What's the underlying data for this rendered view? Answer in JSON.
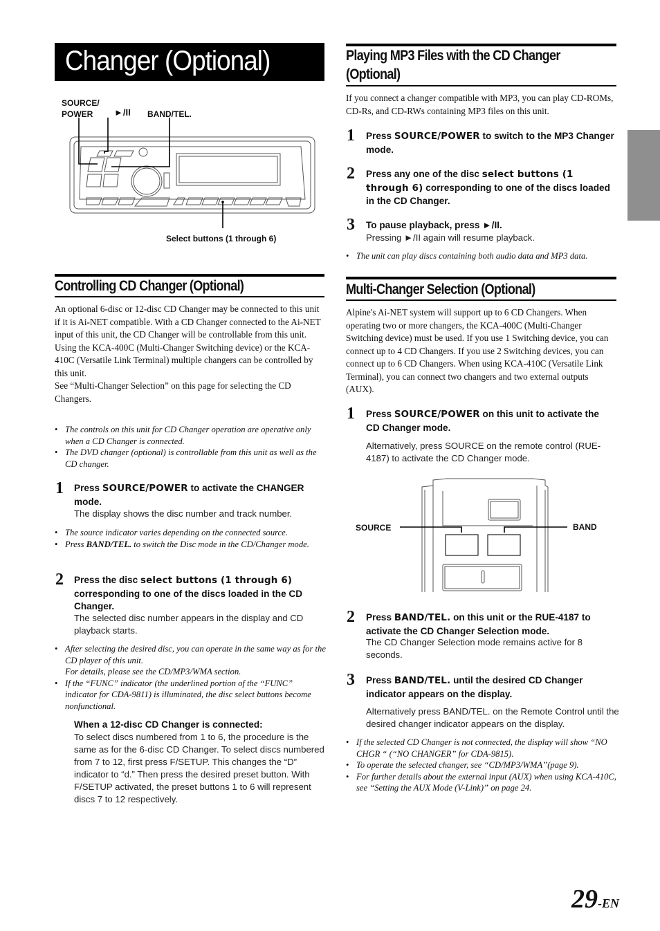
{
  "page": {
    "title": "Changer (Optional)",
    "page_number": "29",
    "page_suffix": "-EN"
  },
  "diagram_unit": {
    "label_source_power_1": "SOURCE/",
    "label_source_power_2": "POWER",
    "label_play_pause": "►/II",
    "label_band_tel": "BAND/TEL.",
    "label_select_buttons": "Select buttons (1 through 6)"
  },
  "controlling": {
    "heading": "Controlling CD Changer (Optional)",
    "paragraphs": [
      "An optional 6-disc or 12-disc CD Changer may be connected to this unit if it is Ai-NET compatible. With a CD Changer connected to the Ai-NET input of this unit, the CD Changer will be controllable from this unit.",
      "Using the KCA-400C (Multi-Changer Switching device) or the KCA-410C (Versatile Link Terminal) multiple changers can be controlled by this unit.",
      "See “Multi-Changer Selection” on this page for selecting the CD Changers."
    ],
    "notes_1": [
      "The controls on this unit for CD Changer operation are operative only when a CD Changer is connected.",
      "The DVD changer (optional) is controllable from this unit as well as the CD changer."
    ],
    "step1": {
      "num": "1",
      "pre": "Press ",
      "kw": "SOURCE/POWER",
      "post": " to activate the CHANGER mode.",
      "body": "The display shows the disc number and track number."
    },
    "notes_2": [
      "The source indicator varies depending on the connected source."
    ],
    "note_2b_pre": "Press ",
    "note_2b_kw": "BAND/TEL.",
    "note_2b_post": " to switch the Disc mode in the CD/Changer mode.",
    "step2": {
      "num": "2",
      "pre": "Press the disc ",
      "kw": "select buttons (1 through 6)",
      "post": " corresponding to one of the discs loaded in the CD Changer.",
      "body": "The selected disc number appears in the display and CD playback starts."
    },
    "notes_3a": "After selecting the desired disc, you can operate in the same way as for the CD player of this unit.",
    "notes_3a2": "For details, please see the CD/MP3/WMA section.",
    "notes_3b": "If the “FUNC” indicator (the underlined portion of the “FUNC” indicator for CDA-9811) is illuminated, the disc select buttons become nonfunctional.",
    "twelve_disc": {
      "heading": "When a 12-disc CD Changer is connected:",
      "t1": "To select discs numbered from 1 to 6, the procedure is the same as for the 6-disc CD Changer. To select discs numbered from 7 to 12, first press ",
      "k1": "F/SETUP",
      "t2": ". This changes the “D” indicator to “d.” Then press the desired ",
      "k2": "preset button",
      "t3": ". With ",
      "k3": "F/SETUP",
      "t4": " activated, the preset buttons 1 to 6 will represent discs 7 to 12 respectively."
    }
  },
  "mp3": {
    "heading_1": "Playing MP3 Files with the CD Changer",
    "heading_2": "(Optional)",
    "intro": "If you connect a changer compatible with MP3, you can play CD-ROMs, CD-Rs, and CD-RWs containing MP3 files on this unit.",
    "step1": {
      "num": "1",
      "pre": "Press ",
      "kw": "SOURCE/POWER",
      "post": " to switch to the MP3 Changer mode."
    },
    "step2": {
      "num": "2",
      "pre": "Press any one of the disc ",
      "kw": "select buttons (1 through 6)",
      "post": " corresponding to one of the discs loaded in the CD Changer."
    },
    "step3": {
      "num": "3",
      "head": "To pause playback, press ►/II.",
      "body": "Pressing ►/II again will resume playback."
    },
    "note": "The unit can play discs containing both audio data and MP3 data."
  },
  "multi": {
    "heading": "Multi-Changer Selection (Optional)",
    "intro": "Alpine's Ai-NET system will support up to 6 CD Changers. When operating two or more changers, the KCA-400C (Multi-Changer Switching device) must be used. If you use 1 Switching device, you can connect up to 4 CD Changers. If you use 2 Switching devices, you can connect up to 6 CD Changers. When using KCA-410C (Versatile Link Terminal), you can connect two changers and two external outputs (AUX).",
    "step1": {
      "num": "1",
      "pre": "Press ",
      "kw": "SOURCE/POWER",
      "post": " on this unit to activate the CD Changer mode.",
      "body_pre": "Alternatively, press ",
      "body_kw": "SOURCE",
      "body_post": " on the remote control (RUE-4187) to activate the CD Changer mode."
    },
    "remote_labels": {
      "source": "SOURCE",
      "band": "BAND"
    },
    "step2": {
      "num": "2",
      "pre": "Press ",
      "kw": "BAND/TEL.",
      "post": " on this unit or the RUE-4187 to activate the CD Changer Selection mode.",
      "body": "The CD Changer Selection mode remains active for 8 seconds."
    },
    "step3": {
      "num": "3",
      "pre": "Press ",
      "kw": "BAND/TEL.",
      "post": " until the desired CD Changer indicator appears on the display.",
      "body_pre": "Alternatively press ",
      "body_kw": "BAND/TEL.",
      "body_post": " on the Remote Control until the desired changer indicator appears on the display."
    },
    "notes": [
      "If the selected CD Changer is not connected, the display will show “NO CHGR “ (“NO CHANGER” for CDA-9815).",
      "To operate the selected changer, see “CD/MP3/WMA”(page 9).",
      "For further details about the external input (AUX) when using KCA-410C, see “Setting the AUX Mode (V-Link)” on page 24."
    ]
  }
}
